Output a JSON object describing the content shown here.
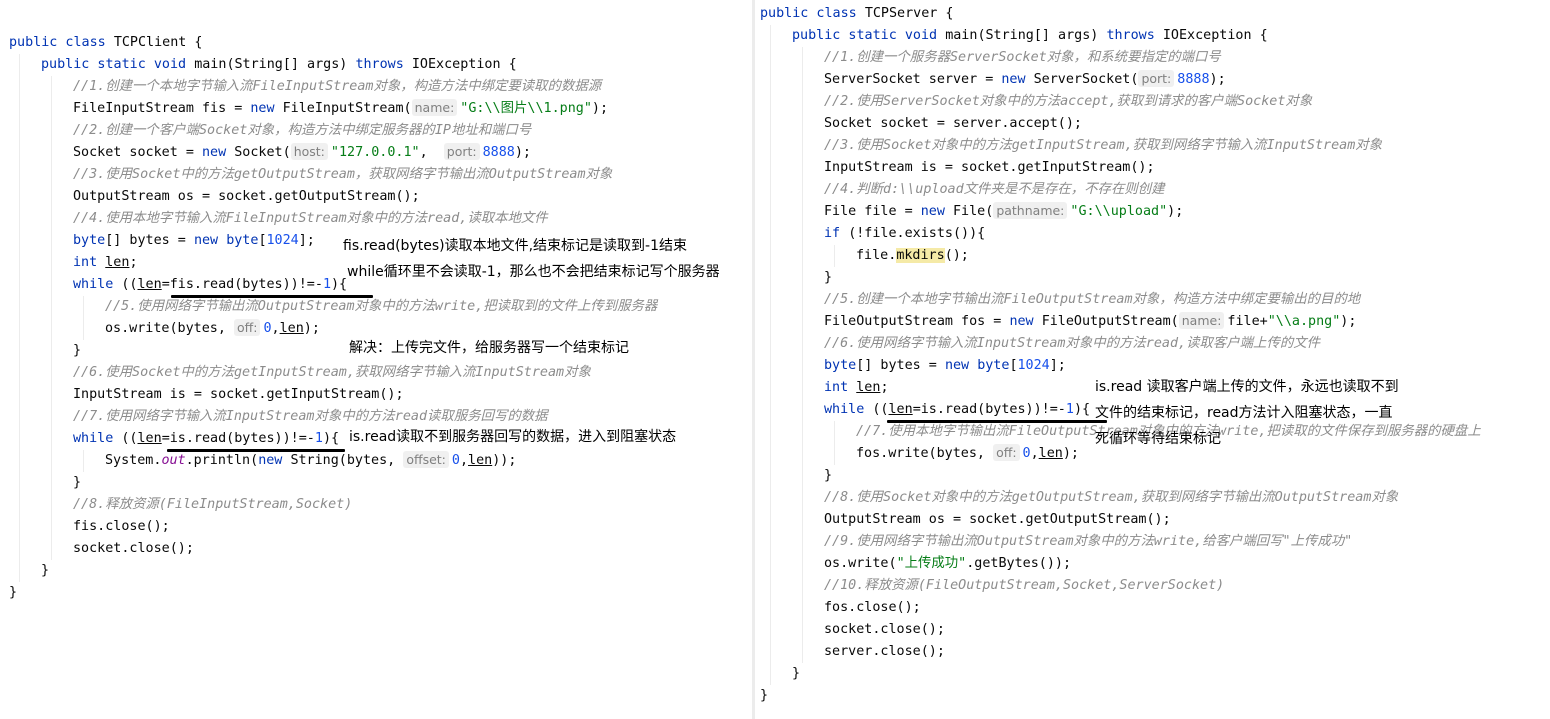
{
  "left": {
    "lines": [
      {
        "indent": 0,
        "segs": [
          {
            "t": "public class ",
            "c": "kw"
          },
          {
            "t": "TCPClient {",
            "c": "plain"
          }
        ]
      },
      {
        "indent": 1,
        "segs": [
          {
            "t": "public static void ",
            "c": "kw"
          },
          {
            "t": "main",
            "c": "plain"
          },
          {
            "t": "(String[] args) ",
            "c": "plain"
          },
          {
            "t": "throws ",
            "c": "kw"
          },
          {
            "t": "IOException {",
            "c": "plain"
          }
        ]
      },
      {
        "indent": 2,
        "segs": [
          {
            "t": "//1.创建一个本地字节输入流FileInputStream对象，构造方法中绑定要读取的数据源",
            "c": "cmt"
          }
        ]
      },
      {
        "indent": 2,
        "segs": [
          {
            "t": "FileInputStream fis = ",
            "c": "plain"
          },
          {
            "t": "new ",
            "c": "kw"
          },
          {
            "t": "FileInputStream(",
            "c": "plain"
          },
          {
            "t": "name:",
            "c": "hint"
          },
          {
            "t": "\"G:\\\\图片\\\\1.png\"",
            "c": "str"
          },
          {
            "t": ");",
            "c": "plain"
          }
        ]
      },
      {
        "indent": 2,
        "segs": [
          {
            "t": "//2.创建一个客户端Socket对象，构造方法中绑定服务器的IP地址和端口号",
            "c": "cmt"
          }
        ]
      },
      {
        "indent": 2,
        "segs": [
          {
            "t": "Socket socket = ",
            "c": "plain"
          },
          {
            "t": "new ",
            "c": "kw"
          },
          {
            "t": "Socket(",
            "c": "plain"
          },
          {
            "t": "host:",
            "c": "hint"
          },
          {
            "t": "\"127.0.0.1\"",
            "c": "str"
          },
          {
            "t": ",  ",
            "c": "plain"
          },
          {
            "t": "port:",
            "c": "hint"
          },
          {
            "t": "8888",
            "c": "num"
          },
          {
            "t": ");",
            "c": "plain"
          }
        ]
      },
      {
        "indent": 2,
        "segs": [
          {
            "t": "//3.使用Socket中的方法getOutputStream，获取网络字节输出流OutputStream对象",
            "c": "cmt"
          }
        ]
      },
      {
        "indent": 2,
        "segs": [
          {
            "t": "OutputStream os = socket.getOutputStream();",
            "c": "plain"
          }
        ]
      },
      {
        "indent": 2,
        "segs": [
          {
            "t": "//4.使用本地字节输入流FileInputStream对象中的方法read,读取本地文件",
            "c": "cmt"
          }
        ]
      },
      {
        "indent": 2,
        "segs": [
          {
            "t": "byte",
            "c": "kw"
          },
          {
            "t": "[] bytes = ",
            "c": "plain"
          },
          {
            "t": "new ",
            "c": "kw"
          },
          {
            "t": "byte",
            "c": "kw"
          },
          {
            "t": "[",
            "c": "plain"
          },
          {
            "t": "1024",
            "c": "num"
          },
          {
            "t": "];",
            "c": "plain"
          }
        ]
      },
      {
        "indent": 2,
        "segs": [
          {
            "t": "int ",
            "c": "kw"
          },
          {
            "t": "len",
            "c": "ul"
          },
          {
            "t": ";",
            "c": "plain"
          }
        ]
      },
      {
        "indent": 2,
        "segs": [
          {
            "t": "while ",
            "c": "kw"
          },
          {
            "t": "((",
            "c": "plain"
          },
          {
            "t": "len",
            "c": "ul"
          },
          {
            "t": "=fis.read(bytes))!=-",
            "c": "plain"
          },
          {
            "t": "1",
            "c": "num"
          },
          {
            "t": "){",
            "c": "plain"
          }
        ]
      },
      {
        "indent": 3,
        "segs": [
          {
            "t": "//5.使用网络字节输出流OutputStream对象中的方法write,把读取到的文件上传到服务器",
            "c": "cmt"
          }
        ]
      },
      {
        "indent": 3,
        "segs": [
          {
            "t": "os.write(bytes, ",
            "c": "plain"
          },
          {
            "t": "off:",
            "c": "hint"
          },
          {
            "t": "0",
            "c": "num"
          },
          {
            "t": ",",
            "c": "plain"
          },
          {
            "t": "len",
            "c": "ul"
          },
          {
            "t": ");",
            "c": "plain"
          }
        ]
      },
      {
        "indent": 2,
        "segs": [
          {
            "t": "}",
            "c": "plain"
          }
        ]
      },
      {
        "indent": 2,
        "segs": [
          {
            "t": "//6.使用Socket中的方法getInputStream,获取网络字节输入流InputStream对象",
            "c": "cmt"
          }
        ]
      },
      {
        "indent": 2,
        "segs": [
          {
            "t": "InputStream is = socket.getInputStream();",
            "c": "plain"
          }
        ]
      },
      {
        "indent": 2,
        "segs": [
          {
            "t": "//7.使用网络字节输入流InputStream对象中的方法read读取服务回写的数据",
            "c": "cmt"
          }
        ]
      },
      {
        "indent": 2,
        "segs": [
          {
            "t": "while ",
            "c": "kw"
          },
          {
            "t": "((",
            "c": "plain"
          },
          {
            "t": "len",
            "c": "ul"
          },
          {
            "t": "=is.read(bytes))!=-",
            "c": "plain"
          },
          {
            "t": "1",
            "c": "num"
          },
          {
            "t": "){",
            "c": "plain"
          }
        ]
      },
      {
        "indent": 3,
        "segs": [
          {
            "t": "System.",
            "c": "plain"
          },
          {
            "t": "out",
            "c": "fld"
          },
          {
            "t": ".println(",
            "c": "plain"
          },
          {
            "t": "new ",
            "c": "kw"
          },
          {
            "t": "String(bytes, ",
            "c": "plain"
          },
          {
            "t": "offset:",
            "c": "hint"
          },
          {
            "t": "0",
            "c": "num"
          },
          {
            "t": ",",
            "c": "plain"
          },
          {
            "t": "len",
            "c": "ul"
          },
          {
            "t": "));",
            "c": "plain"
          }
        ]
      },
      {
        "indent": 2,
        "segs": [
          {
            "t": "}",
            "c": "plain"
          }
        ]
      },
      {
        "indent": 2,
        "segs": [
          {
            "t": "//8.释放资源(FileInputStream,Socket)",
            "c": "cmt"
          }
        ]
      },
      {
        "indent": 2,
        "segs": [
          {
            "t": "fis.close();",
            "c": "plain"
          }
        ]
      },
      {
        "indent": 2,
        "segs": [
          {
            "t": "socket.close();",
            "c": "plain"
          }
        ]
      },
      {
        "indent": 1,
        "segs": [
          {
            "t": "}",
            "c": "plain"
          }
        ]
      },
      {
        "indent": 0,
        "segs": [
          {
            "t": "}",
            "c": "plain"
          }
        ]
      }
    ]
  },
  "right": {
    "lines": [
      {
        "indent": 0,
        "segs": [
          {
            "t": "public class ",
            "c": "kw"
          },
          {
            "t": "TCPServer {",
            "c": "plain"
          }
        ]
      },
      {
        "indent": 1,
        "segs": [
          {
            "t": "public static void ",
            "c": "kw"
          },
          {
            "t": "main",
            "c": "plain"
          },
          {
            "t": "(String[] args) ",
            "c": "plain"
          },
          {
            "t": "throws ",
            "c": "kw"
          },
          {
            "t": "IOException {",
            "c": "plain"
          }
        ]
      },
      {
        "indent": 2,
        "segs": [
          {
            "t": "//1.创建一个服务器ServerSocket对象，和系统要指定的端口号",
            "c": "cmt"
          }
        ]
      },
      {
        "indent": 2,
        "segs": [
          {
            "t": "ServerSocket server = ",
            "c": "plain"
          },
          {
            "t": "new ",
            "c": "kw"
          },
          {
            "t": "ServerSocket(",
            "c": "plain"
          },
          {
            "t": "port:",
            "c": "hint"
          },
          {
            "t": "8888",
            "c": "num"
          },
          {
            "t": ");",
            "c": "plain"
          }
        ]
      },
      {
        "indent": 2,
        "segs": [
          {
            "t": "//2.使用ServerSocket对象中的方法accept,获取到请求的客户端Socket对象",
            "c": "cmt"
          }
        ]
      },
      {
        "indent": 2,
        "segs": [
          {
            "t": "Socket socket = server.accept();",
            "c": "plain"
          }
        ]
      },
      {
        "indent": 2,
        "segs": [
          {
            "t": "//3.使用Socket对象中的方法getInputStream,获取到网络字节输入流InputStream对象",
            "c": "cmt"
          }
        ]
      },
      {
        "indent": 2,
        "segs": [
          {
            "t": "InputStream is = socket.getInputStream();",
            "c": "plain"
          }
        ]
      },
      {
        "indent": 2,
        "segs": [
          {
            "t": "//4.判断d:\\\\upload文件夹是不是存在，不存在则创建",
            "c": "cmt"
          }
        ]
      },
      {
        "indent": 2,
        "segs": [
          {
            "t": "File file = ",
            "c": "plain"
          },
          {
            "t": "new ",
            "c": "kw"
          },
          {
            "t": "File(",
            "c": "plain"
          },
          {
            "t": "pathname:",
            "c": "hint"
          },
          {
            "t": "\"G:\\\\upload\"",
            "c": "str"
          },
          {
            "t": ");",
            "c": "plain"
          }
        ]
      },
      {
        "indent": 2,
        "segs": [
          {
            "t": "if ",
            "c": "kw"
          },
          {
            "t": "(!file.exists()){",
            "c": "plain"
          }
        ]
      },
      {
        "indent": 3,
        "segs": [
          {
            "t": "file.",
            "c": "plain"
          },
          {
            "t": "mkdirs",
            "c": "hl"
          },
          {
            "t": "();",
            "c": "plain"
          }
        ]
      },
      {
        "indent": 2,
        "segs": [
          {
            "t": "}",
            "c": "plain"
          }
        ]
      },
      {
        "indent": 2,
        "segs": [
          {
            "t": "//5.创建一个本地字节输出流FileOutputStream对象，构造方法中绑定要输出的目的地",
            "c": "cmt"
          }
        ]
      },
      {
        "indent": 2,
        "segs": [
          {
            "t": "FileOutputStream fos = ",
            "c": "plain"
          },
          {
            "t": "new ",
            "c": "kw"
          },
          {
            "t": "FileOutputStream(",
            "c": "plain"
          },
          {
            "t": "name:",
            "c": "hint"
          },
          {
            "t": "file+",
            "c": "plain"
          },
          {
            "t": "\"\\\\a.png\"",
            "c": "str"
          },
          {
            "t": ");",
            "c": "plain"
          }
        ]
      },
      {
        "indent": 2,
        "segs": [
          {
            "t": "//6.使用网络字节输入流InputStream对象中的方法read,读取客户端上传的文件",
            "c": "cmt"
          }
        ]
      },
      {
        "indent": 2,
        "segs": [
          {
            "t": "byte",
            "c": "kw"
          },
          {
            "t": "[] bytes = ",
            "c": "plain"
          },
          {
            "t": "new ",
            "c": "kw"
          },
          {
            "t": "byte",
            "c": "kw"
          },
          {
            "t": "[",
            "c": "plain"
          },
          {
            "t": "1024",
            "c": "num"
          },
          {
            "t": "];",
            "c": "plain"
          }
        ]
      },
      {
        "indent": 2,
        "segs": [
          {
            "t": "int ",
            "c": "kw"
          },
          {
            "t": "len",
            "c": "ul"
          },
          {
            "t": ";",
            "c": "plain"
          }
        ]
      },
      {
        "indent": 2,
        "segs": [
          {
            "t": "while ",
            "c": "kw"
          },
          {
            "t": "((",
            "c": "plain"
          },
          {
            "t": "len",
            "c": "ul"
          },
          {
            "t": "=is.read(bytes))!=-",
            "c": "plain"
          },
          {
            "t": "1",
            "c": "num"
          },
          {
            "t": "){",
            "c": "plain"
          }
        ]
      },
      {
        "indent": 3,
        "segs": [
          {
            "t": "//7.使用本地字节输出流FileOutputStream对象中的方法write,把读取的文件保存到服务器的硬盘上",
            "c": "cmt"
          }
        ]
      },
      {
        "indent": 3,
        "segs": [
          {
            "t": "fos.write(bytes, ",
            "c": "plain"
          },
          {
            "t": "off:",
            "c": "hint"
          },
          {
            "t": "0",
            "c": "num"
          },
          {
            "t": ",",
            "c": "plain"
          },
          {
            "t": "len",
            "c": "ul"
          },
          {
            "t": ");",
            "c": "plain"
          }
        ]
      },
      {
        "indent": 2,
        "segs": [
          {
            "t": "}",
            "c": "plain"
          }
        ]
      },
      {
        "indent": 2,
        "segs": [
          {
            "t": "//8.使用Socket对象中的方法getOutputStream,获取到网络字节输出流OutputStream对象",
            "c": "cmt"
          }
        ]
      },
      {
        "indent": 2,
        "segs": [
          {
            "t": "OutputStream os = socket.getOutputStream();",
            "c": "plain"
          }
        ]
      },
      {
        "indent": 2,
        "segs": [
          {
            "t": "//9.使用网络字节输出流OutputStream对象中的方法write,给客户端回写\"上传成功\"",
            "c": "cmt"
          }
        ]
      },
      {
        "indent": 2,
        "segs": [
          {
            "t": "os.write(",
            "c": "plain"
          },
          {
            "t": "\"上传成功\"",
            "c": "str"
          },
          {
            "t": ".getBytes());",
            "c": "plain"
          }
        ]
      },
      {
        "indent": 2,
        "segs": [
          {
            "t": "//10.释放资源(FileOutputStream,Socket,ServerSocket)",
            "c": "cmt"
          }
        ]
      },
      {
        "indent": 2,
        "segs": [
          {
            "t": "fos.close();",
            "c": "plain"
          }
        ]
      },
      {
        "indent": 2,
        "segs": [
          {
            "t": "socket.close();",
            "c": "plain"
          }
        ]
      },
      {
        "indent": 2,
        "segs": [
          {
            "t": "server.close();",
            "c": "plain"
          }
        ]
      },
      {
        "indent": 1,
        "segs": [
          {
            "t": "}",
            "c": "plain"
          }
        ]
      },
      {
        "indent": 0,
        "segs": [
          {
            "t": "}",
            "c": "plain"
          }
        ]
      }
    ]
  },
  "annotations": {
    "fis_read": "fis.read(bytes)读取本地文件,结束标记是读取到-1结束",
    "while_no_minus1": "while循环里不会读取-1，那么也不会把结束标记写个服务器",
    "solution": "解决：上传完文件，给服务器写一个结束标记",
    "is_read_blocked": "is.read读取不到服务器回写的数据，进入到阻塞状态",
    "server_read_1": "is.read 读取客户端上传的文件，永远也读取不到",
    "server_read_2": "文件的结束标记，read方法计入阻塞状态，一直",
    "server_read_3": "死循环等待结束标记"
  }
}
